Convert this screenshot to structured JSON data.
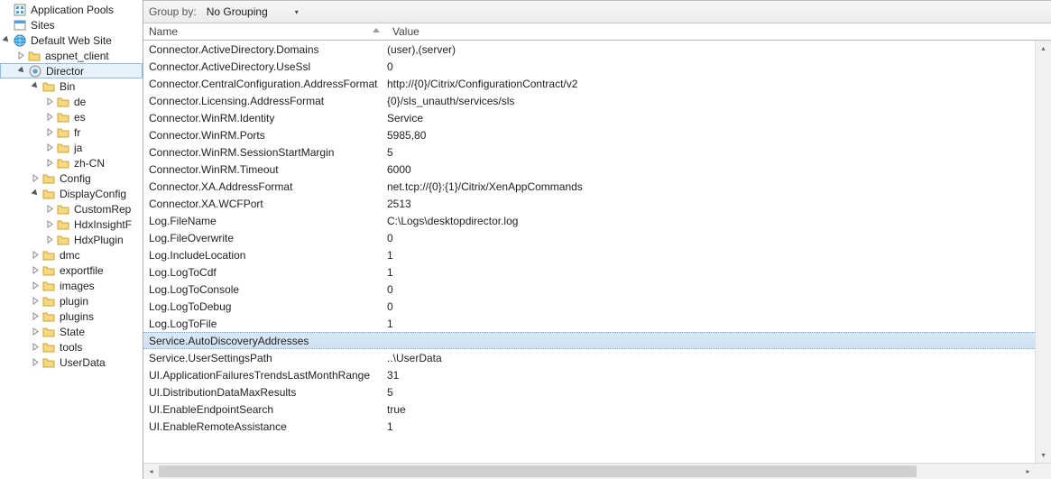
{
  "tree": {
    "app_pools": "Application Pools",
    "sites": "Sites",
    "default_web_site": "Default Web Site",
    "aspnet_client": "aspnet_client",
    "director": "Director",
    "bin": "Bin",
    "de": "de",
    "es": "es",
    "fr": "fr",
    "ja": "ja",
    "zh_cn": "zh-CN",
    "config": "Config",
    "displayconfig": "DisplayConfig",
    "customrep": "CustomRep",
    "hdxinsight": "HdxInsightF",
    "hdxplugin": "HdxPlugin",
    "dmc": "dmc",
    "exportfile": "exportfile",
    "images": "images",
    "plugin": "plugin",
    "plugins": "plugins",
    "state": "State",
    "tools": "tools",
    "userdata": "UserData"
  },
  "groupby": {
    "label": "Group by:",
    "value": "No Grouping"
  },
  "columns": {
    "name": "Name",
    "value": "Value"
  },
  "rows": [
    {
      "name": "Connector.ActiveDirectory.Domains",
      "value": "(user),(server)"
    },
    {
      "name": "Connector.ActiveDirectory.UseSsl",
      "value": "0"
    },
    {
      "name": "Connector.CentralConfiguration.AddressFormat",
      "value": "http://{0}/Citrix/ConfigurationContract/v2"
    },
    {
      "name": "Connector.Licensing.AddressFormat",
      "value": "{0}/sls_unauth/services/sls"
    },
    {
      "name": "Connector.WinRM.Identity",
      "value": "Service"
    },
    {
      "name": "Connector.WinRM.Ports",
      "value": "5985,80"
    },
    {
      "name": "Connector.WinRM.SessionStartMargin",
      "value": "5"
    },
    {
      "name": "Connector.WinRM.Timeout",
      "value": "6000"
    },
    {
      "name": "Connector.XA.AddressFormat",
      "value": "net.tcp://{0}:{1}/Citrix/XenAppCommands"
    },
    {
      "name": "Connector.XA.WCFPort",
      "value": "2513"
    },
    {
      "name": "Log.FileName",
      "value": "C:\\Logs\\desktopdirector.log"
    },
    {
      "name": "Log.FileOverwrite",
      "value": "0"
    },
    {
      "name": "Log.IncludeLocation",
      "value": "1"
    },
    {
      "name": "Log.LogToCdf",
      "value": "1"
    },
    {
      "name": "Log.LogToConsole",
      "value": "0"
    },
    {
      "name": "Log.LogToDebug",
      "value": "0"
    },
    {
      "name": "Log.LogToFile",
      "value": "1"
    },
    {
      "name": "Service.AutoDiscoveryAddresses",
      "value": "",
      "selected": true
    },
    {
      "name": "Service.UserSettingsPath",
      "value": "..\\UserData"
    },
    {
      "name": "UI.ApplicationFailuresTrendsLastMonthRange",
      "value": "31"
    },
    {
      "name": "UI.DistributionDataMaxResults",
      "value": "5"
    },
    {
      "name": "UI.EnableEndpointSearch",
      "value": "true"
    },
    {
      "name": "UI.EnableRemoteAssistance",
      "value": "1"
    }
  ]
}
